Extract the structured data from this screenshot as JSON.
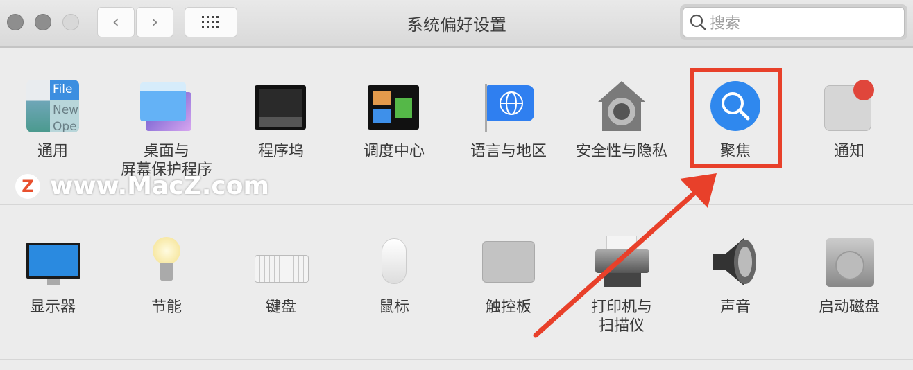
{
  "window": {
    "title": "系统偏好设置"
  },
  "toolbar": {
    "search_placeholder": "搜索",
    "back": "‹",
    "forward": "›"
  },
  "row1": [
    {
      "label": "通用",
      "icon": "general-icon"
    },
    {
      "label": "桌面与\n屏幕保护程序",
      "icon": "desktop-screensaver-icon"
    },
    {
      "label": "程序坞",
      "icon": "dock-icon"
    },
    {
      "label": "调度中心",
      "icon": "mission-control-icon"
    },
    {
      "label": "语言与地区",
      "icon": "language-region-icon"
    },
    {
      "label": "安全性与隐私",
      "icon": "security-privacy-icon"
    },
    {
      "label": "聚焦",
      "icon": "spotlight-icon"
    },
    {
      "label": "通知",
      "icon": "notifications-icon"
    }
  ],
  "row2": [
    {
      "label": "显示器",
      "icon": "displays-icon"
    },
    {
      "label": "节能",
      "icon": "energy-saver-icon"
    },
    {
      "label": "键盘",
      "icon": "keyboard-icon"
    },
    {
      "label": "鼠标",
      "icon": "mouse-icon"
    },
    {
      "label": "触控板",
      "icon": "trackpad-icon"
    },
    {
      "label": "打印机与\n扫描仪",
      "icon": "printers-scanners-icon"
    },
    {
      "label": "声音",
      "icon": "sound-icon"
    },
    {
      "label": "启动磁盘",
      "icon": "startup-disk-icon"
    }
  ],
  "general_icon_text": {
    "file": "File",
    "new": "New",
    "open": "Ope"
  },
  "watermark": {
    "logo": "Z",
    "text": "www.MacZ.com"
  },
  "annotation": {
    "color": "#e8402a",
    "highlighted": "聚焦"
  }
}
